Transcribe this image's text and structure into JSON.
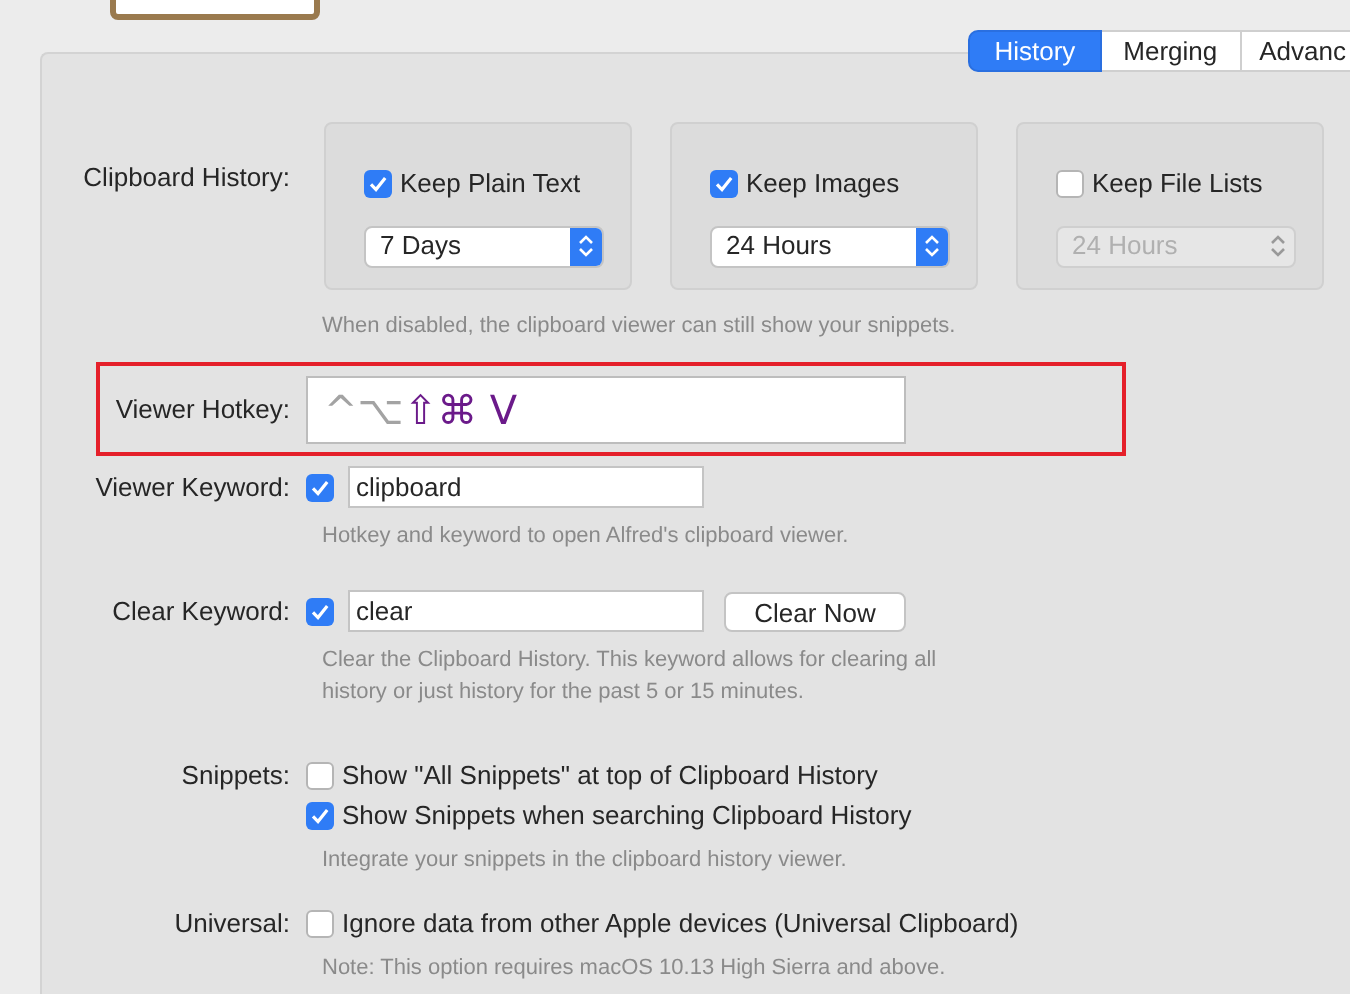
{
  "tabs": [
    {
      "label": "History",
      "selected": true
    },
    {
      "label": "Merging",
      "selected": false
    },
    {
      "label": "Advanc",
      "selected": false
    }
  ],
  "clipboard_history": {
    "label": "Clipboard History:",
    "groups": [
      {
        "label": "Keep Plain Text",
        "checked": true,
        "duration": "7 Days",
        "disabled": false
      },
      {
        "label": "Keep Images",
        "checked": true,
        "duration": "24 Hours",
        "disabled": false
      },
      {
        "label": "Keep File Lists",
        "checked": false,
        "duration": "24 Hours",
        "disabled": true
      }
    ],
    "note": "When disabled, the clipboard viewer can still show your snippets."
  },
  "viewer_hotkey": {
    "label": "Viewer Hotkey:",
    "highlighted": true,
    "keys": [
      {
        "symbol": "^",
        "active": false
      },
      {
        "symbol": "⌥",
        "active": false
      },
      {
        "symbol": "⇧",
        "active": true
      },
      {
        "symbol": "⌘",
        "active": true
      },
      {
        "symbol": " V",
        "active": true
      }
    ]
  },
  "viewer_keyword": {
    "label": "Viewer Keyword:",
    "checked": true,
    "value": "clipboard",
    "note": "Hotkey and keyword to open Alfred's clipboard viewer."
  },
  "clear_keyword": {
    "label": "Clear Keyword:",
    "checked": true,
    "value": "clear",
    "button": "Clear Now",
    "note": "Clear the Clipboard History. This keyword allows for clearing all history or just history for the past 5 or 15 minutes."
  },
  "snippets": {
    "label": "Snippets:",
    "options": [
      {
        "label": "Show \"All Snippets\" at top of Clipboard History",
        "checked": false
      },
      {
        "label": "Show Snippets when searching Clipboard History",
        "checked": true
      }
    ],
    "note": "Integrate your snippets in the clipboard history viewer."
  },
  "universal": {
    "label": "Universal:",
    "options": [
      {
        "label": "Ignore data from other Apple devices (Universal Clipboard)",
        "checked": false
      }
    ],
    "note": "Note: This option requires macOS 10.13 High Sierra and above."
  }
}
